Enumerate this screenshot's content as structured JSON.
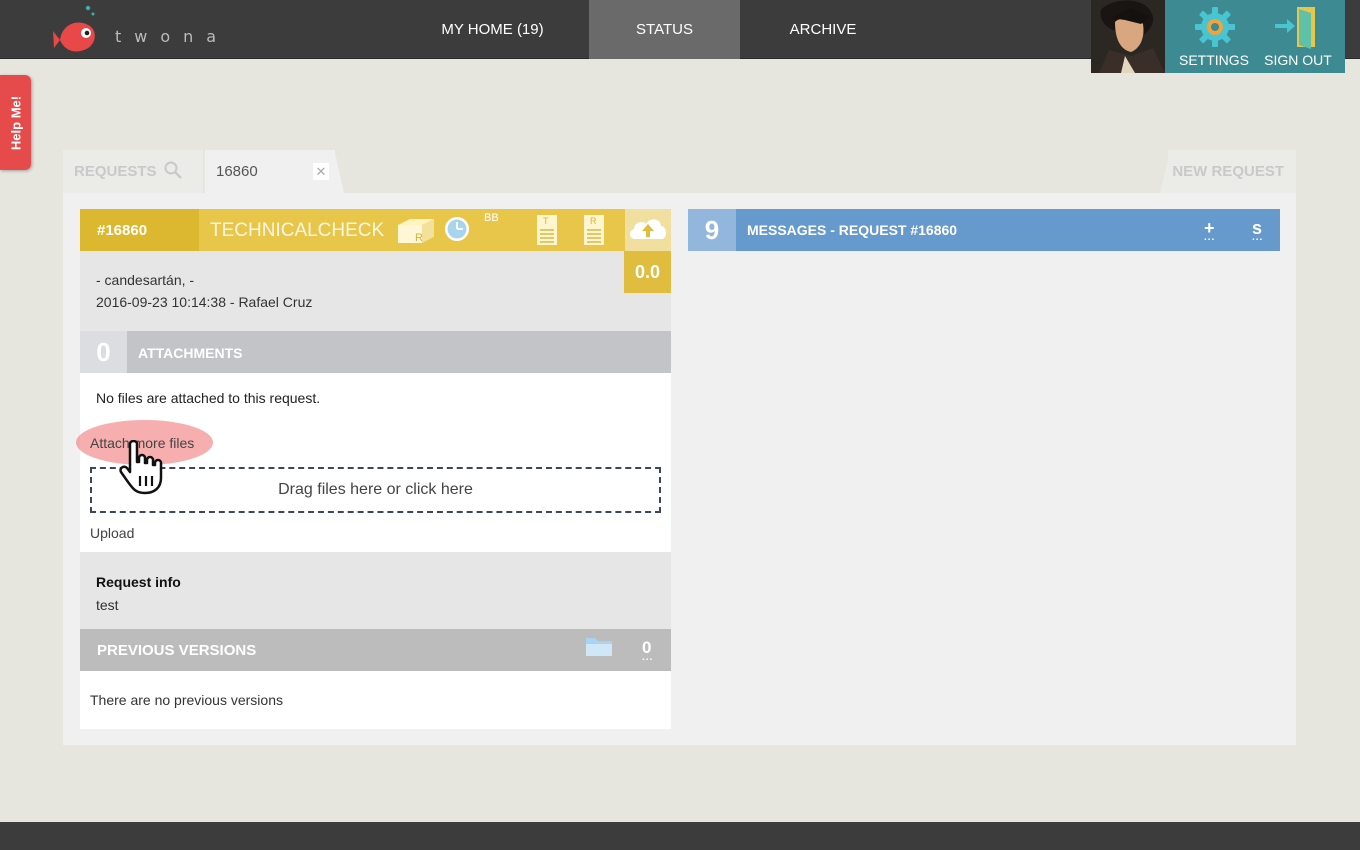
{
  "app": {
    "logo_text": "twona"
  },
  "nav": {
    "home": "MY HOME (19)",
    "status": "STATUS",
    "archive": "ARCHIVE",
    "settings": "SETTINGS",
    "signout": "SIGN OUT"
  },
  "help": {
    "label": "Help Me!"
  },
  "tabs": {
    "requests": "REQUESTS",
    "active": "16860",
    "new_request": "NEW REQUEST"
  },
  "request": {
    "id": "#16860",
    "type": "TECHNICALCHECK",
    "bb": "BB",
    "r_label": "R",
    "t_label": "T",
    "score": "0.0",
    "line1": "- candesartán, -",
    "line2": "2016-09-23 10:14:38 - Rafael Cruz"
  },
  "attachments": {
    "count": "0",
    "title": "ATTACHMENTS",
    "empty_text": "No files are attached to this request.",
    "attach_link": "Attach more files",
    "dropzone": "Drag files here or click here",
    "upload": "Upload"
  },
  "info": {
    "title": "Request info",
    "text": "test"
  },
  "previous_versions": {
    "title": "PREVIOUS VERSIONS",
    "count": "0",
    "dots": "...",
    "empty_text": "There are no previous versions"
  },
  "messages": {
    "count": "9",
    "title": "MESSAGES - REQUEST #16860",
    "add": "+",
    "s": "s",
    "dots": "..."
  },
  "colors": {
    "topbar": "#3c3c3c",
    "accent_teal": "#3d8a93",
    "request_yellow": "#e8c64a",
    "messages_blue": "#6699cc",
    "help_red": "#e54b4b"
  },
  "icons": [
    "fish-logo-icon",
    "gear-icon",
    "door-exit-icon",
    "search-icon",
    "close-icon",
    "box-icon",
    "clock-icon",
    "document-icon",
    "cloud-upload-icon",
    "folder-icon",
    "pointer-hand-icon"
  ]
}
